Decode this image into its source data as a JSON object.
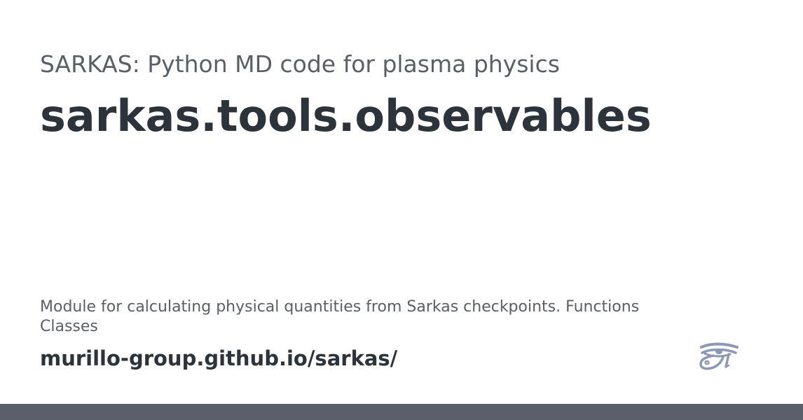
{
  "card": {
    "site_name": "SARKAS: Python MD code for plasma physics",
    "title": "sarkas.tools.observables",
    "description_line1": "Module for calculating physical quantities from Sarkas checkpoints. Functions",
    "description_line2": "Classes",
    "url": "murillo-group.github.io/sarkas/",
    "logo_icon": "eye-of-horus-icon"
  },
  "colors": {
    "title_text": "#2c333b",
    "muted_text": "#5a5f66",
    "logo": "#8d99b4",
    "bottom_bar": "#5a5f6b"
  }
}
